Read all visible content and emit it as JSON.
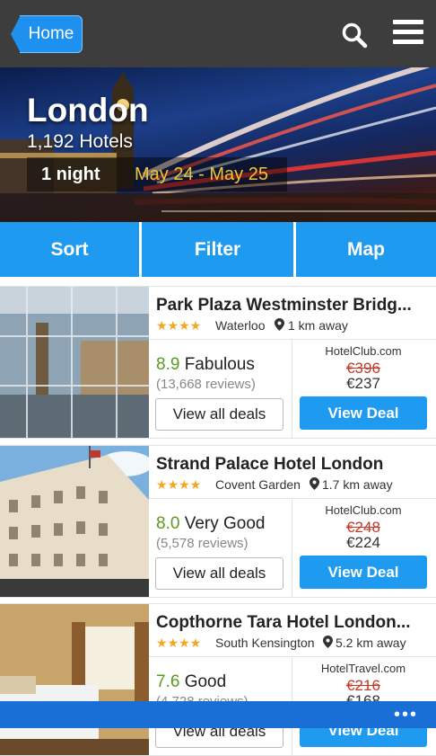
{
  "topbar": {
    "home_label": "Home"
  },
  "hero": {
    "city": "London",
    "count": "1,192 Hotels",
    "nights": "1 night",
    "dates": "May 24 - May 25"
  },
  "actions": {
    "sort": "Sort",
    "filter": "Filter",
    "map": "Map"
  },
  "hotels": [
    {
      "name": "Park Plaza Westminster Bridg...",
      "stars": "★★★★",
      "area": "Waterloo",
      "distance": "1 km away",
      "rating": "8.9",
      "rating_text": "Fabulous",
      "reviews": "(13,668 reviews)",
      "deals_label": "View all deals",
      "site": "HotelClub.com",
      "old_price": "€396",
      "new_price": "€237",
      "view_label": "View Deal"
    },
    {
      "name": "Strand Palace Hotel London",
      "stars": "★★★★",
      "area": "Covent Garden",
      "distance": "1.7 km away",
      "rating": "8.0",
      "rating_text": "Very Good",
      "reviews": "(5,578 reviews)",
      "deals_label": "View all deals",
      "site": "HotelClub.com",
      "old_price": "€248",
      "new_price": "€224",
      "view_label": "View Deal"
    },
    {
      "name": "Copthorne Tara Hotel London...",
      "stars": "★★★★",
      "area": "South Kensington",
      "distance": "5.2 km away",
      "rating": "7.6",
      "rating_text": "Good",
      "reviews": "(4,728 reviews)",
      "deals_label": "View all deals",
      "site": "HotelTravel.com",
      "old_price": "€216",
      "new_price": "€168",
      "view_label": "View Deal"
    }
  ],
  "colors": {
    "accent": "#1e9bf0",
    "topbar": "#3d3d3d",
    "rating_green": "#5b9a1e",
    "old_price": "#c0392b",
    "date_yellow": "#f2c531"
  },
  "icons": {
    "search": "search-icon",
    "menu": "menu-icon",
    "pin": "location-pin-icon",
    "more": "more-icon"
  }
}
